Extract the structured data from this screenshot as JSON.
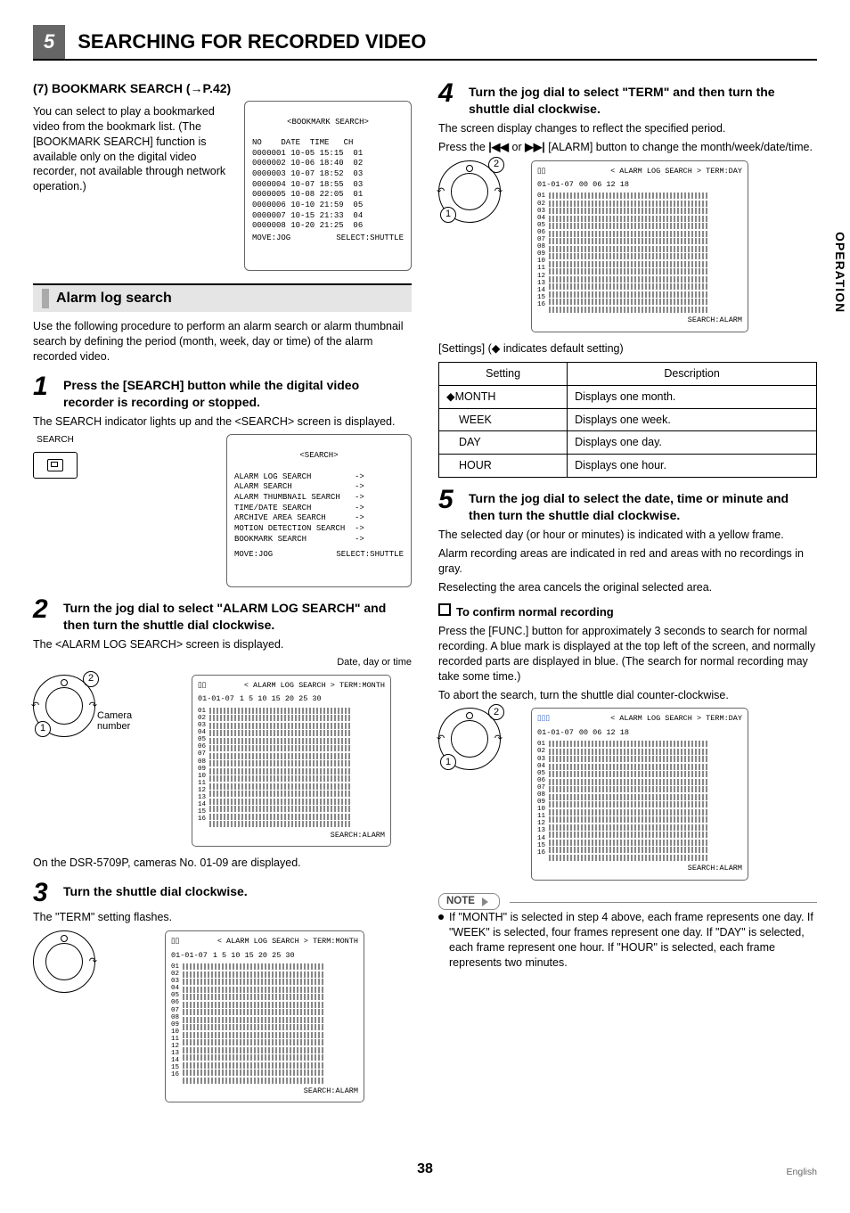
{
  "chapter": {
    "number": "5",
    "title": "SEARCHING FOR RECORDED VIDEO"
  },
  "side_tab": "OPERATION",
  "page_number": "38",
  "lang_label": "English",
  "bookmark_sec": {
    "heading": "(7)  BOOKMARK SEARCH (→P.42)",
    "body": "You can select to play a bookmarked video from the bookmark list.\n(The [BOOKMARK SEARCH] function is available only on the digital video recorder, not available through network operation.)",
    "screen": {
      "title": "<BOOKMARK SEARCH>",
      "header": "NO    DATE  TIME   CH",
      "rows": [
        "0000001 10-05 15:15  01",
        "0000002 10-06 18:40  02",
        "0000003 10-07 18:52  03",
        "0000004 10-07 18:55  03",
        "0000005 10-08 22:05  01",
        "0000006 10-10 21:59  05",
        "0000007 10-15 21:33  04",
        "0000008 10-20 21:25  06"
      ],
      "footer_left": "MOVE:JOG",
      "footer_right": "SELECT:SHUTTLE"
    }
  },
  "alarm_head": "Alarm log search",
  "alarm_intro": "Use the following procedure to perform an alarm search or alarm thumbnail search by defining the period (month, week, day or time) of the alarm recorded video.",
  "step1": {
    "n": "1",
    "title": "Press the [SEARCH] button while the digital video recorder is recording or stopped.",
    "body": "The SEARCH indicator lights up and the <SEARCH> screen is displayed.",
    "btn_label": "SEARCH",
    "screen": {
      "title": "<SEARCH>",
      "rows": [
        "ALARM LOG SEARCH         ->",
        "ALARM SEARCH             ->",
        "ALARM THUMBNAIL SEARCH   ->",
        "TIME/DATE SEARCH         ->",
        "ARCHIVE AREA SEARCH      ->",
        "MOTION DETECTION SEARCH  ->",
        "BOOKMARK SEARCH          ->"
      ],
      "footer_left": "MOVE:JOG",
      "footer_right": "SELECT:SHUTTLE"
    }
  },
  "step2": {
    "n": "2",
    "title": "Turn the jog dial to select \"ALARM LOG SEARCH\" and then turn the shuttle dial clockwise.",
    "body": "The <ALARM LOG SEARCH> screen is displayed.",
    "label_date": "Date, day or time",
    "label_camera": "Camera number",
    "screen": {
      "header": "< ALARM LOG SEARCH > TERM:MONTH",
      "date": "01-01-07",
      "axis": "1   5   10   15   20   25   30",
      "footer": "SEARCH:ALARM"
    },
    "note": "On the DSR-5709P, cameras No. 01-09 are displayed.",
    "jog": {
      "c1": "1",
      "c2": "2"
    }
  },
  "step3": {
    "n": "3",
    "title": "Turn the shuttle dial clockwise.",
    "body": "The \"TERM\" setting flashes.",
    "screen": {
      "header": "< ALARM LOG SEARCH > TERM:MONTH",
      "date": "01-01-07",
      "axis": "1   5   10   15   20   25   30",
      "footer": "SEARCH:ALARM"
    }
  },
  "step4": {
    "n": "4",
    "title": "Turn the jog dial to select \"TERM\" and then turn the shuttle dial clockwise.",
    "body1": "The screen display changes to reflect the specified period.",
    "body2_pre": "Press the ",
    "body2_mid": " or ",
    "body2_post": " [ALARM] button to change the month/week/date/time.",
    "screen": {
      "header": "< ALARM LOG SEARCH > TERM:DAY",
      "date": "01-01-07",
      "axis": "00   06   12   18",
      "footer": "SEARCH:ALARM"
    },
    "jog": {
      "c1": "1",
      "c2": "2"
    },
    "settings_intro": "[Settings] (◆ indicates default setting)",
    "table": {
      "h1": "Setting",
      "h2": "Description",
      "rows": [
        {
          "s": "◆MONTH",
          "d": "Displays one month."
        },
        {
          "s": "WEEK",
          "d": "Displays one week."
        },
        {
          "s": "DAY",
          "d": "Displays one day."
        },
        {
          "s": "HOUR",
          "d": "Displays one hour."
        }
      ]
    }
  },
  "step5": {
    "n": "5",
    "title": "Turn the jog dial to select the date, time or minute and then turn the shuttle dial clockwise.",
    "body1": "The selected day (or hour or minutes) is indicated with a yellow frame.",
    "body2": "Alarm recording areas are indicated in red and areas with no recordings in gray.",
    "body3": "Reselecting the area cancels the original selected area.",
    "subhead": "To confirm normal recording",
    "sub1": "Press the [FUNC.] button for approximately 3 seconds to search for normal recording. A blue mark is displayed at the top left of the screen, and normally recorded parts are displayed in blue. (The search for normal recording may take some time.)",
    "sub2": "To abort the search, turn the shuttle dial counter-clockwise.",
    "screen": {
      "header": "< ALARM LOG SEARCH > TERM:DAY",
      "date": "01-01-07",
      "axis": "00   06   12   18",
      "footer": "SEARCH:ALARM"
    },
    "jog": {
      "c1": "1",
      "c2": "2"
    },
    "note_label": "NOTE",
    "note_body": "If \"MONTH\" is selected in step 4 above, each frame represents one day. If \"WEEK\" is selected, four frames represent one day. If \"DAY\" is selected, each frame represent one hour. If \"HOUR\" is selected, each frame represents two minutes."
  },
  "cam_list": [
    "01",
    "02",
    "03",
    "04",
    "05",
    "06",
    "07",
    "08",
    "09",
    "10",
    "11",
    "12",
    "13",
    "14",
    "15",
    "16"
  ]
}
